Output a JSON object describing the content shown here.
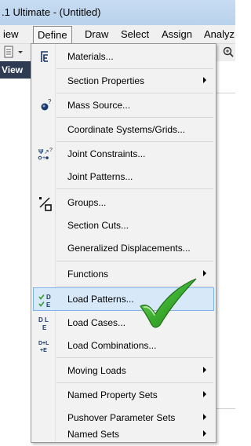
{
  "title": ".1 Ultimate  - (Untitled)",
  "menubar": {
    "items": [
      "iew",
      "Define",
      "Draw",
      "Select",
      "Assign",
      "Analyz"
    ],
    "open_index": 1
  },
  "left_tab": "View",
  "dropdown": {
    "items": [
      {
        "label": "Materials...",
        "icon": "materials-icon",
        "submenu": false
      },
      {
        "label": "Section Properties",
        "icon": "",
        "submenu": true
      },
      {
        "label": "Mass Source...",
        "icon": "mass-source-icon",
        "submenu": false
      },
      {
        "label": "Coordinate Systems/Grids...",
        "icon": "",
        "submenu": false
      },
      {
        "label": "Joint Constraints...",
        "icon": "joint-constraints-icon",
        "submenu": false
      },
      {
        "label": "Joint Patterns...",
        "icon": "",
        "submenu": false
      },
      {
        "label": "Groups...",
        "icon": "groups-icon",
        "submenu": false
      },
      {
        "label": "Section Cuts...",
        "icon": "",
        "submenu": false
      },
      {
        "label": "Generalized Displacements...",
        "icon": "",
        "submenu": false
      },
      {
        "label": "Functions",
        "icon": "",
        "submenu": true
      },
      {
        "label": "Load Patterns...",
        "icon": "load-patterns-icon",
        "submenu": false,
        "highlighted": true
      },
      {
        "label": "Load Cases...",
        "icon": "load-cases-icon",
        "submenu": false
      },
      {
        "label": "Load Combinations...",
        "icon": "load-combinations-icon",
        "submenu": false
      },
      {
        "label": "Moving Loads",
        "icon": "",
        "submenu": true
      },
      {
        "label": "Named Property Sets",
        "icon": "",
        "submenu": true
      },
      {
        "label": "Pushover Parameter Sets",
        "icon": "",
        "submenu": true
      },
      {
        "label": "Named Sets",
        "icon": "",
        "submenu": true
      }
    ]
  },
  "icon_glyphs": {
    "load_patterns_top": "D",
    "load_patterns_bottom": "E",
    "load_cases_top": "D L",
    "load_cases_bottom": "E",
    "load_combinations_top": "D+L",
    "load_combinations_bottom": "+E",
    "joint_constraints_top": "?"
  },
  "colors": {
    "highlight": "#d7e8f8",
    "highlight_border": "#7eb4ea",
    "check_green": "#3cae2f",
    "left_tab_bg": "#2e3b52"
  }
}
